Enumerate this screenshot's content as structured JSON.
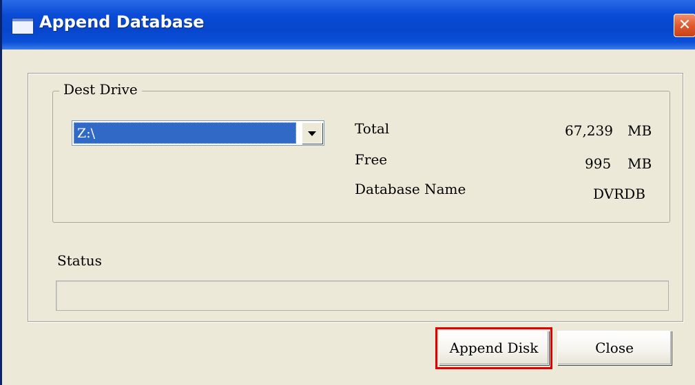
{
  "window": {
    "title": "Append Database",
    "close_label": "✕"
  },
  "dest_drive": {
    "group_label": "Dest Drive",
    "selected_drive": "Z:\\",
    "total_label": "Total",
    "total_value": "67,239",
    "total_unit": "MB",
    "free_label": "Free",
    "free_value": "995",
    "free_unit": "MB",
    "dbname_label": "Database Name",
    "dbname_value": "DVRDB"
  },
  "status": {
    "label": "Status",
    "text": ""
  },
  "buttons": {
    "append_disk": "Append Disk",
    "close": "Close"
  },
  "colors": {
    "title_bar": "#0a4bd6",
    "highlight": "#e00000",
    "selection": "#3169c6"
  },
  "icons": {
    "window_icon": "window-icon",
    "close": "close-icon",
    "dropdown": "chevron-down-icon"
  }
}
